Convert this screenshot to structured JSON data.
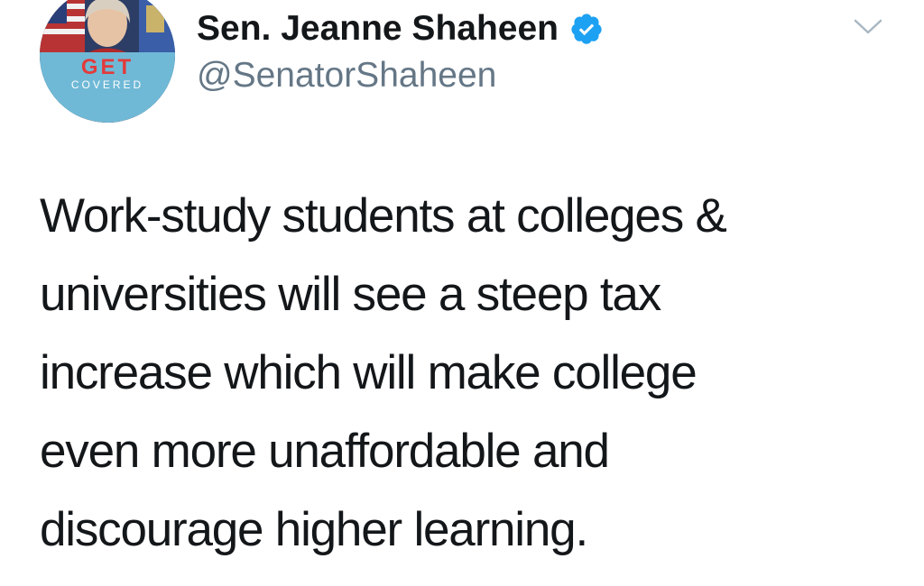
{
  "tweet": {
    "author": {
      "display_name": "Sen. Jeanne Shaheen",
      "handle": "@SenatorShaheen",
      "verified_icon": "verified-badge-icon",
      "avatar_badge_top": "GET",
      "avatar_badge_bottom": "COVERED"
    },
    "menu_icon": "chevron-down-icon",
    "text_lines": [
      "Work-study students at colleges &",
      "universities will see a steep tax",
      "increase which will make college",
      "even more unaffordable and",
      "discourage higher learning."
    ]
  },
  "colors": {
    "verified_blue": "#1da1f2",
    "handle_gray": "#657786",
    "text_dark": "#14171a",
    "badge_red": "#e23b3b",
    "badge_blue": "#6fb9d6"
  }
}
